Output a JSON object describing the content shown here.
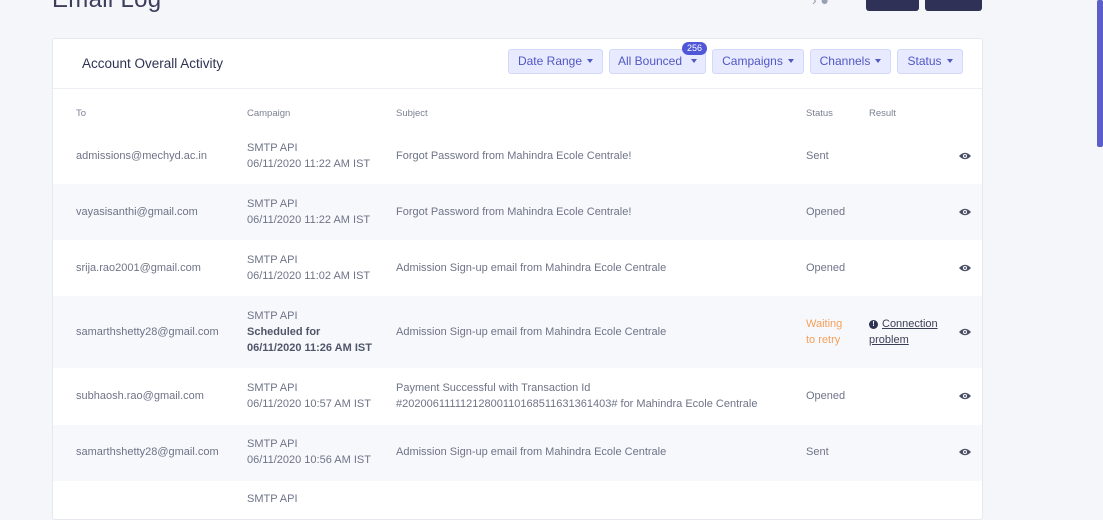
{
  "page": {
    "title": "Email Log"
  },
  "card": {
    "title": "Account Overall Activity",
    "filters": {
      "date_range": "Date Range",
      "all_bounced": "All Bounced",
      "bounced_count": "256",
      "campaigns": "Campaigns",
      "channels": "Channels",
      "status": "Status"
    }
  },
  "table": {
    "headers": {
      "to": "To",
      "campaign": "Campaign",
      "subject": "Subject",
      "status": "Status",
      "result": "Result"
    },
    "rows": [
      {
        "to": "admissions@mechyd.ac.in",
        "campaign": "SMTP API",
        "date": "06/11/2020 11:22 AM IST",
        "subject": "Forgot Password from Mahindra Ecole Centrale!",
        "status": "Sent"
      },
      {
        "to": "vayasisanthi@gmail.com",
        "campaign": "SMTP API",
        "date": "06/11/2020 11:22 AM IST",
        "subject": "Forgot Password from Mahindra Ecole Centrale!",
        "status": "Opened"
      },
      {
        "to": "srija.rao2001@gmail.com",
        "campaign": "SMTP API",
        "date": "06/11/2020 11:02 AM IST",
        "subject": "Admission Sign-up email from Mahindra Ecole Centrale",
        "status": "Opened"
      },
      {
        "to": "samarthshetty28@gmail.com",
        "campaign": "SMTP API",
        "scheduled_label": "Scheduled for",
        "date": "06/11/2020 11:26 AM IST",
        "subject": "Admission Sign-up email from Mahindra Ecole Centrale",
        "status_line1": "Waiting",
        "status_line2": "to retry",
        "result_line1": "Connection",
        "result_line2": "problem"
      },
      {
        "to": "subhaosh.rao@gmail.com",
        "campaign": "SMTP API",
        "date": "06/11/2020 10:57 AM IST",
        "subject_line1": "Payment Successful with Transaction Id",
        "subject_line2": "#20200611111212800110168511631361403# for Mahindra Ecole Centrale",
        "status": "Opened"
      },
      {
        "to": "samarthshetty28@gmail.com",
        "campaign": "SMTP API",
        "date": "06/11/2020 10:56 AM IST",
        "subject": "Admission Sign-up email from Mahindra Ecole Centrale",
        "status": "Sent"
      },
      {
        "campaign": "SMTP API"
      }
    ]
  },
  "colors": {
    "accent": "#5058c4",
    "filter_bg": "#e8eaff",
    "badge": "#4f57d8",
    "warning": "#f5a05a",
    "dark_button": "#2f3157"
  },
  "icons": [
    "eye-icon",
    "caret-down-icon",
    "info-icon"
  ]
}
